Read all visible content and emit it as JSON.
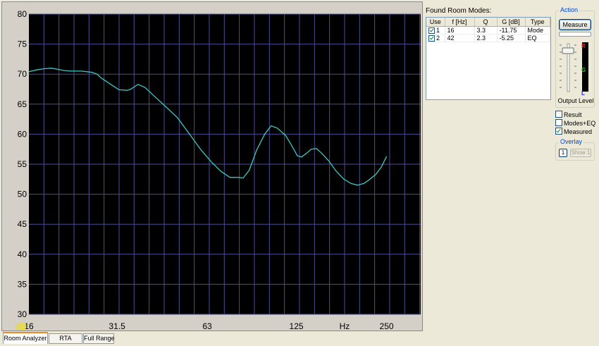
{
  "chart_data": {
    "type": "line",
    "xscale": "log",
    "x_tick_labels": [
      "16",
      "31.5",
      "63",
      "125",
      "Hz",
      "250"
    ],
    "y_tick_labels": [
      "80",
      "75",
      "70",
      "65",
      "60",
      "55",
      "50",
      "45",
      "40",
      "35",
      "30"
    ],
    "xlabel": "Hz",
    "ylabel": "dB",
    "xlim": [
      16,
      325
    ],
    "ylim": [
      30,
      80
    ],
    "grid": true,
    "series": [
      {
        "color": "#3fc7c7",
        "points": [
          [
            16,
            70.4
          ],
          [
            17,
            70.7
          ],
          [
            18,
            70.9
          ],
          [
            19,
            71.0
          ],
          [
            20,
            70.8
          ],
          [
            21,
            70.6
          ],
          [
            22,
            70.5
          ],
          [
            24,
            70.5
          ],
          [
            26,
            70.3
          ],
          [
            27,
            70.0
          ],
          [
            28,
            69.3
          ],
          [
            30,
            68.3
          ],
          [
            32,
            67.4
          ],
          [
            34,
            67.3
          ],
          [
            35,
            67.5
          ],
          [
            37,
            68.3
          ],
          [
            39,
            67.8
          ],
          [
            42,
            66.3
          ],
          [
            46,
            64.5
          ],
          [
            50,
            62.8
          ],
          [
            55,
            60.0
          ],
          [
            60,
            57.4
          ],
          [
            65,
            55.4
          ],
          [
            70,
            53.8
          ],
          [
            75,
            52.8
          ],
          [
            80,
            52.8
          ],
          [
            83,
            52.7
          ],
          [
            87,
            54.0
          ],
          [
            92,
            57.3
          ],
          [
            98,
            60.0
          ],
          [
            103,
            61.4
          ],
          [
            108,
            61.0
          ],
          [
            115,
            59.8
          ],
          [
            120,
            58.3
          ],
          [
            126,
            56.4
          ],
          [
            130,
            56.2
          ],
          [
            135,
            56.8
          ],
          [
            140,
            57.5
          ],
          [
            146,
            57.6
          ],
          [
            152,
            56.8
          ],
          [
            160,
            55.6
          ],
          [
            170,
            53.8
          ],
          [
            180,
            52.5
          ],
          [
            190,
            51.8
          ],
          [
            200,
            51.5
          ],
          [
            210,
            51.8
          ],
          [
            220,
            52.5
          ],
          [
            230,
            53.3
          ],
          [
            240,
            54.5
          ],
          [
            250,
            56.3
          ]
        ]
      }
    ]
  },
  "modes": {
    "title": "Found Room Modes:",
    "columns": [
      "Use",
      "f [Hz]",
      "Q",
      "G [dB]",
      "Type"
    ],
    "rows": [
      {
        "use": "1",
        "freq": "16",
        "q": "3.3",
        "gain": "-11.75",
        "type": "Mode"
      },
      {
        "use": "2",
        "freq": "42",
        "q": "2.3",
        "gain": "-5.25",
        "type": "EQ"
      }
    ]
  },
  "action": {
    "legend": "Action",
    "measure_label": "Measure",
    "output_level_label": "Output Level",
    "meter_letters": {
      "top": "R",
      "mid": "G",
      "bottom": "L"
    },
    "meter_colors": {
      "top": "#ff2020",
      "mid": "#20c020",
      "bottom": "#2020ff"
    }
  },
  "display": {
    "result_label": "Result",
    "result_checked": false,
    "modes_eq_label": "Modes+EQ",
    "modes_eq_checked": false,
    "measured_label": "Measured",
    "measured_checked": true
  },
  "overlay": {
    "legend": "Overlay",
    "button_1": "1",
    "show_label": "Show 1"
  },
  "tabs": {
    "room_analyzer": "Room Analyzer",
    "rta": "RTA",
    "full_range": "Full Range"
  },
  "colors": {
    "plot_bg": "#000000",
    "grid": "#4d4d95",
    "trace": "#3fc7c7",
    "axis_unit_label": "#f0e000"
  }
}
